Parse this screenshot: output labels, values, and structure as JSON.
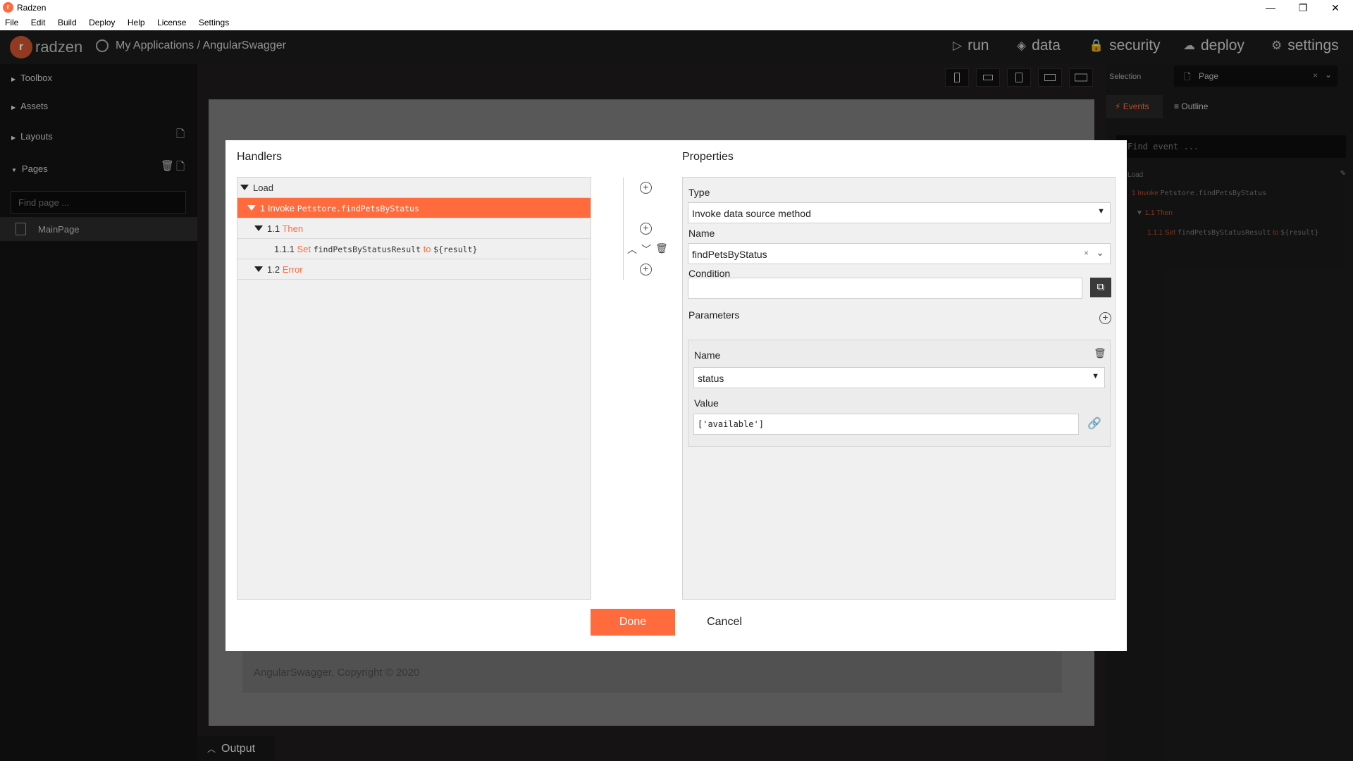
{
  "window": {
    "title": "Radzen",
    "controls": {
      "minimize": "—",
      "maximize": "❐",
      "close": "✕"
    }
  },
  "menu": [
    "File",
    "Edit",
    "Build",
    "Deploy",
    "Help",
    "License",
    "Settings"
  ],
  "header": {
    "brand": "radzen",
    "breadcrumb": "My Applications / AngularSwagger",
    "nav": [
      {
        "label": "run",
        "icon": "▷"
      },
      {
        "label": "data",
        "icon": "◈"
      },
      {
        "label": "security",
        "icon": "🔒"
      },
      {
        "label": "deploy",
        "icon": "☁"
      },
      {
        "label": "settings",
        "icon": "⚙"
      }
    ]
  },
  "sidebar": {
    "items": [
      "Toolbox",
      "Assets",
      "Layouts",
      "Pages"
    ],
    "find_page_placeholder": "Find page ...",
    "pages": [
      "MainPage"
    ]
  },
  "canvas": {
    "footer": "AngularSwagger, Copyright © 2020"
  },
  "output_tab": "Output",
  "right_panel": {
    "selection_label": "Selection",
    "selection_value": "Page",
    "tabs": [
      "Events",
      "Outline"
    ],
    "find_event_placeholder": "Find event ...",
    "events": {
      "load": "Load",
      "l1_num": "1",
      "l1_kw": "Invoke",
      "l1_code": "Petstore.findPetsByStatus",
      "l2_num": "1.1",
      "l2_kw": "Then",
      "l3_num": "1.1.1",
      "l3_kw": "Set",
      "l3_code": "findPetsByStatusResult",
      "l3_to": "to",
      "l3_val": "${result}"
    }
  },
  "dialog": {
    "handlers_title": "Handlers",
    "properties_title": "Properties",
    "tree": {
      "load": "Load",
      "r1_num": "1",
      "r1_kw": "Invoke",
      "r1_code": "Petstore.findPetsByStatus",
      "r2_num": "1.1",
      "r2_kw": "Then",
      "r3_num": "1.1.1",
      "r3_kw": "Set",
      "r3_code": "findPetsByStatusResult",
      "r3_to": "to",
      "r3_val": "${result}",
      "r4_num": "1.2",
      "r4_kw": "Error"
    },
    "properties": {
      "type_label": "Type",
      "type_value": "Invoke data source method",
      "name_label": "Name",
      "name_value": "findPetsByStatus",
      "condition_label": "Condition",
      "condition_value": "",
      "parameters_label": "Parameters",
      "param_name_label": "Name",
      "param_name_value": "status",
      "param_value_label": "Value",
      "param_value_value": "['available']"
    },
    "done": "Done",
    "cancel": "Cancel"
  },
  "colors": {
    "accent": "#ff6b3d",
    "dark": "#1d1b1b"
  }
}
